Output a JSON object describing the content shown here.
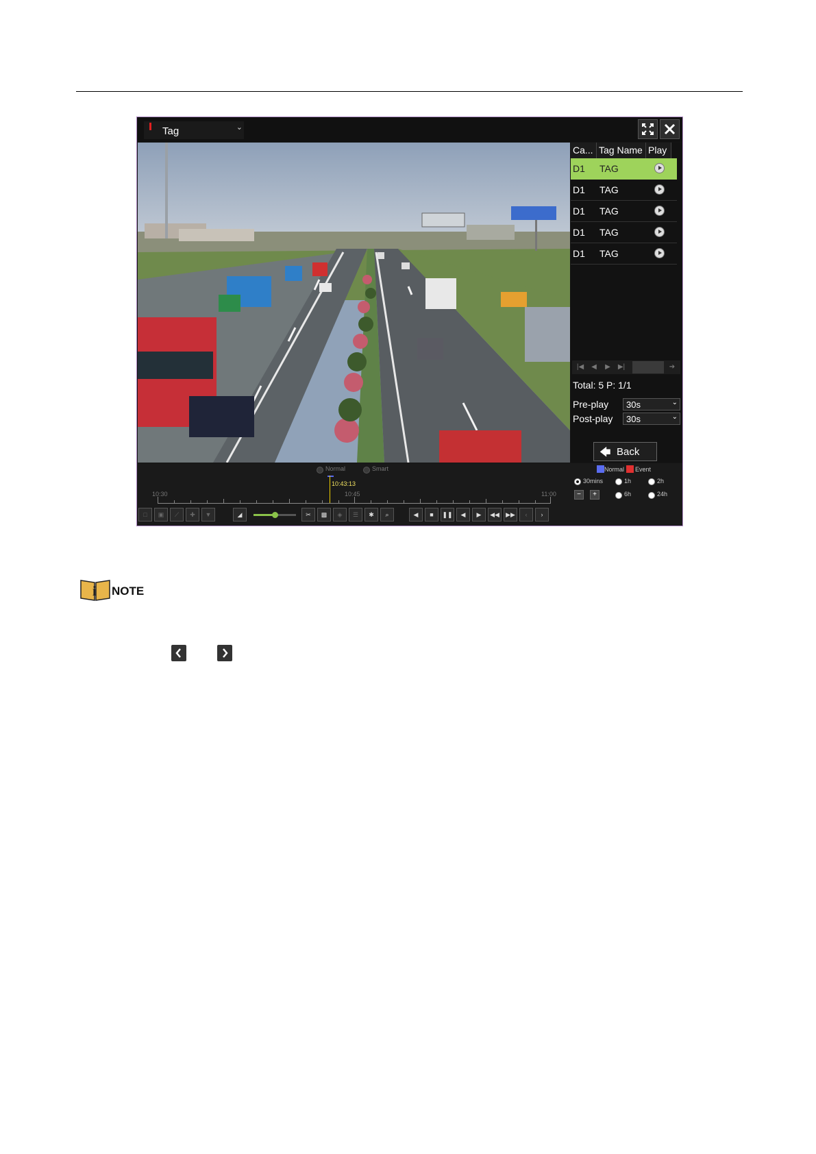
{
  "window": {
    "mode_label": "Tag",
    "fullscreen_icon": "fullscreen-icon",
    "close_icon": "close-icon"
  },
  "tag_list": {
    "columns": [
      "Ca...",
      "Tag Name",
      "Play"
    ],
    "rows": [
      {
        "camera": "D1",
        "tag_name": "TAG",
        "selected": true
      },
      {
        "camera": "D1",
        "tag_name": "TAG",
        "selected": false
      },
      {
        "camera": "D1",
        "tag_name": "TAG",
        "selected": false
      },
      {
        "camera": "D1",
        "tag_name": "TAG",
        "selected": false
      },
      {
        "camera": "D1",
        "tag_name": "TAG",
        "selected": false
      }
    ],
    "total_text": "Total: 5  P: 1/1",
    "pre_play_label": "Pre-play",
    "pre_play_value": "30s",
    "post_play_label": "Post-play",
    "post_play_value": "30s",
    "back_label": "Back",
    "selected_color": "#9ed35b"
  },
  "playback": {
    "play_mode_normal": "Normal",
    "play_mode_smart": "Smart",
    "timeline_start": "10:30",
    "timeline_mid": "10:45",
    "timeline_end": "11:00",
    "current_time": "10:43:13",
    "legend_normal": "Normal",
    "legend_event": "Event",
    "legend_normal_color": "#5a6cf0",
    "legend_event_color": "#e03030",
    "zoom_options": [
      "30mins",
      "1h",
      "2h",
      "6h",
      "24h"
    ],
    "zoom_selected": "30mins",
    "volume_level": 0.5
  },
  "note": {
    "label": "NOTE"
  }
}
